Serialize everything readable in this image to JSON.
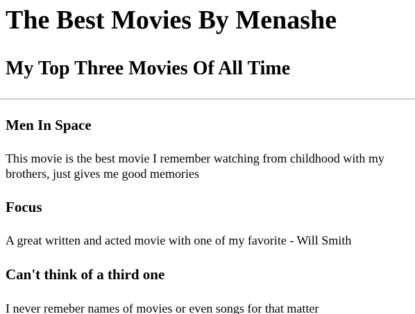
{
  "page": {
    "title": "The Best Movies By Menashe",
    "subtitle": "My Top Three Movies Of All Time"
  },
  "movies": [
    {
      "title": "Men In Space",
      "description": "This movie is the best movie I remember watching from childhood with my brothers, just gives me good memories"
    },
    {
      "title": "Focus",
      "description": "A great written and acted movie with one of my favorite - Will Smith"
    },
    {
      "title": "Can't think of a third one",
      "description": "I never remeber names of movies or even songs for that matter"
    }
  ]
}
